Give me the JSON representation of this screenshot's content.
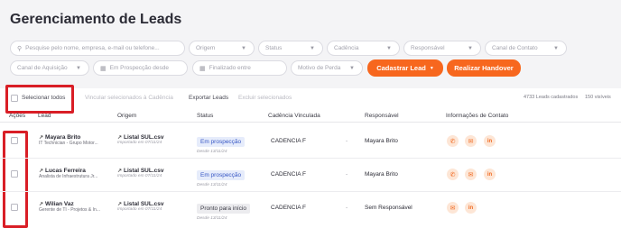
{
  "page": {
    "title": "Gerenciamento de Leads"
  },
  "filters": {
    "search_placeholder": "Pesquise pelo nome, empresa, e-mail ou telefone...",
    "origem": "Origem",
    "status": "Status",
    "cadencia": "Cadência",
    "responsavel": "Responsável",
    "canal_contato": "Canal de Contato",
    "canal_aquisicao": "Canal de Aquisição",
    "em_prospeccao_desde": "Em Prospecção desde",
    "finalizado_entre": "Finalizado entre",
    "motivo_perda": "Motivo de Perda",
    "cadastrar_lead": "Cadastrar Lead",
    "realizar_handover": "Realizar Handover"
  },
  "toolbar": {
    "select_all": "Selecionar todos",
    "vincular": "Vincular selecionados à Cadência",
    "exportar": "Exportar Leads",
    "excluir": "Excluir selecionados",
    "leads_count": "4733 Leads cadastrados",
    "visible_count": "150 visíveis"
  },
  "table": {
    "headers": {
      "acoes": "Ações",
      "lead": "Lead",
      "origem": "Origem",
      "status": "Status",
      "cadencia": "Cadência Vinculada",
      "responsavel": "Responsável",
      "contato": "Informações de Contato"
    },
    "rows": [
      {
        "name": "Mayara Brito",
        "role": "IT Technician - Grupo Motor...",
        "origin": "Listal SUL.csv",
        "imported": "Importado em 07/11/24",
        "status": "Em prospecção",
        "since": "Desde 13/11/24",
        "cadence": "CADENCIA F",
        "dash": "-",
        "owner": "Mayara Brito"
      },
      {
        "name": "Lucas Ferreira",
        "role": "Analista de Infraestrutura Jr...",
        "origin": "Listal SUL.csv",
        "imported": "Importado em 07/11/24",
        "status": "Em prospecção",
        "since": "Desde 13/11/24",
        "cadence": "CADENCIA F",
        "dash": "-",
        "owner": "Mayara Brito"
      },
      {
        "name": "Wilian Vaz",
        "role": "Gerente de TI - Projetos & In...",
        "origin": "Listal SUL.csv",
        "imported": "Importado em 07/11/24",
        "status": "Pronto para início",
        "since": "Desde 13/11/24",
        "cadence": "CADENCIA F",
        "dash": "-",
        "owner": "Sem Responsável"
      }
    ]
  },
  "colors": {
    "accent": "#f7671e",
    "highlight": "#d91e26",
    "badge_blue": "#3656c4"
  }
}
